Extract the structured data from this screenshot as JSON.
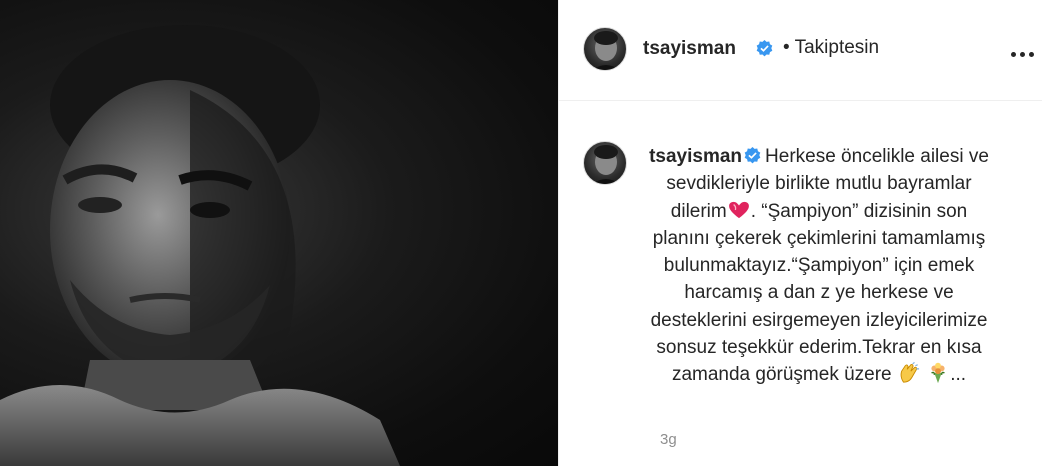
{
  "post": {
    "username": "tsayisman",
    "follow_status": "• Takiptesin",
    "caption_text": "Herkese öncelikle ailesi ve sevdikleriyle birlikte mutlu bayramlar dilerim",
    "caption_rest": ". “Şampiyon” dizisinin son planını çekerek çekimlerini tamamlamış bulunmaktayız.“Şampiyon” için emek harcamış a dan z ye herkese ve desteklerini esirgemeyen izleyicilerimize sonsuz teşekkür ederim.Tekrar en kısa zamanda görüşmek üzere ",
    "caption_ellipsis": "...",
    "timestamp": "3g"
  },
  "colors": {
    "verified": "#3897f0",
    "heart": "#e0245e"
  },
  "icons": [
    "verified-badge-icon",
    "more-options-icon",
    "heart-emoji-icon",
    "clapping-hands-emoji-icon",
    "bouquet-emoji-icon"
  ]
}
